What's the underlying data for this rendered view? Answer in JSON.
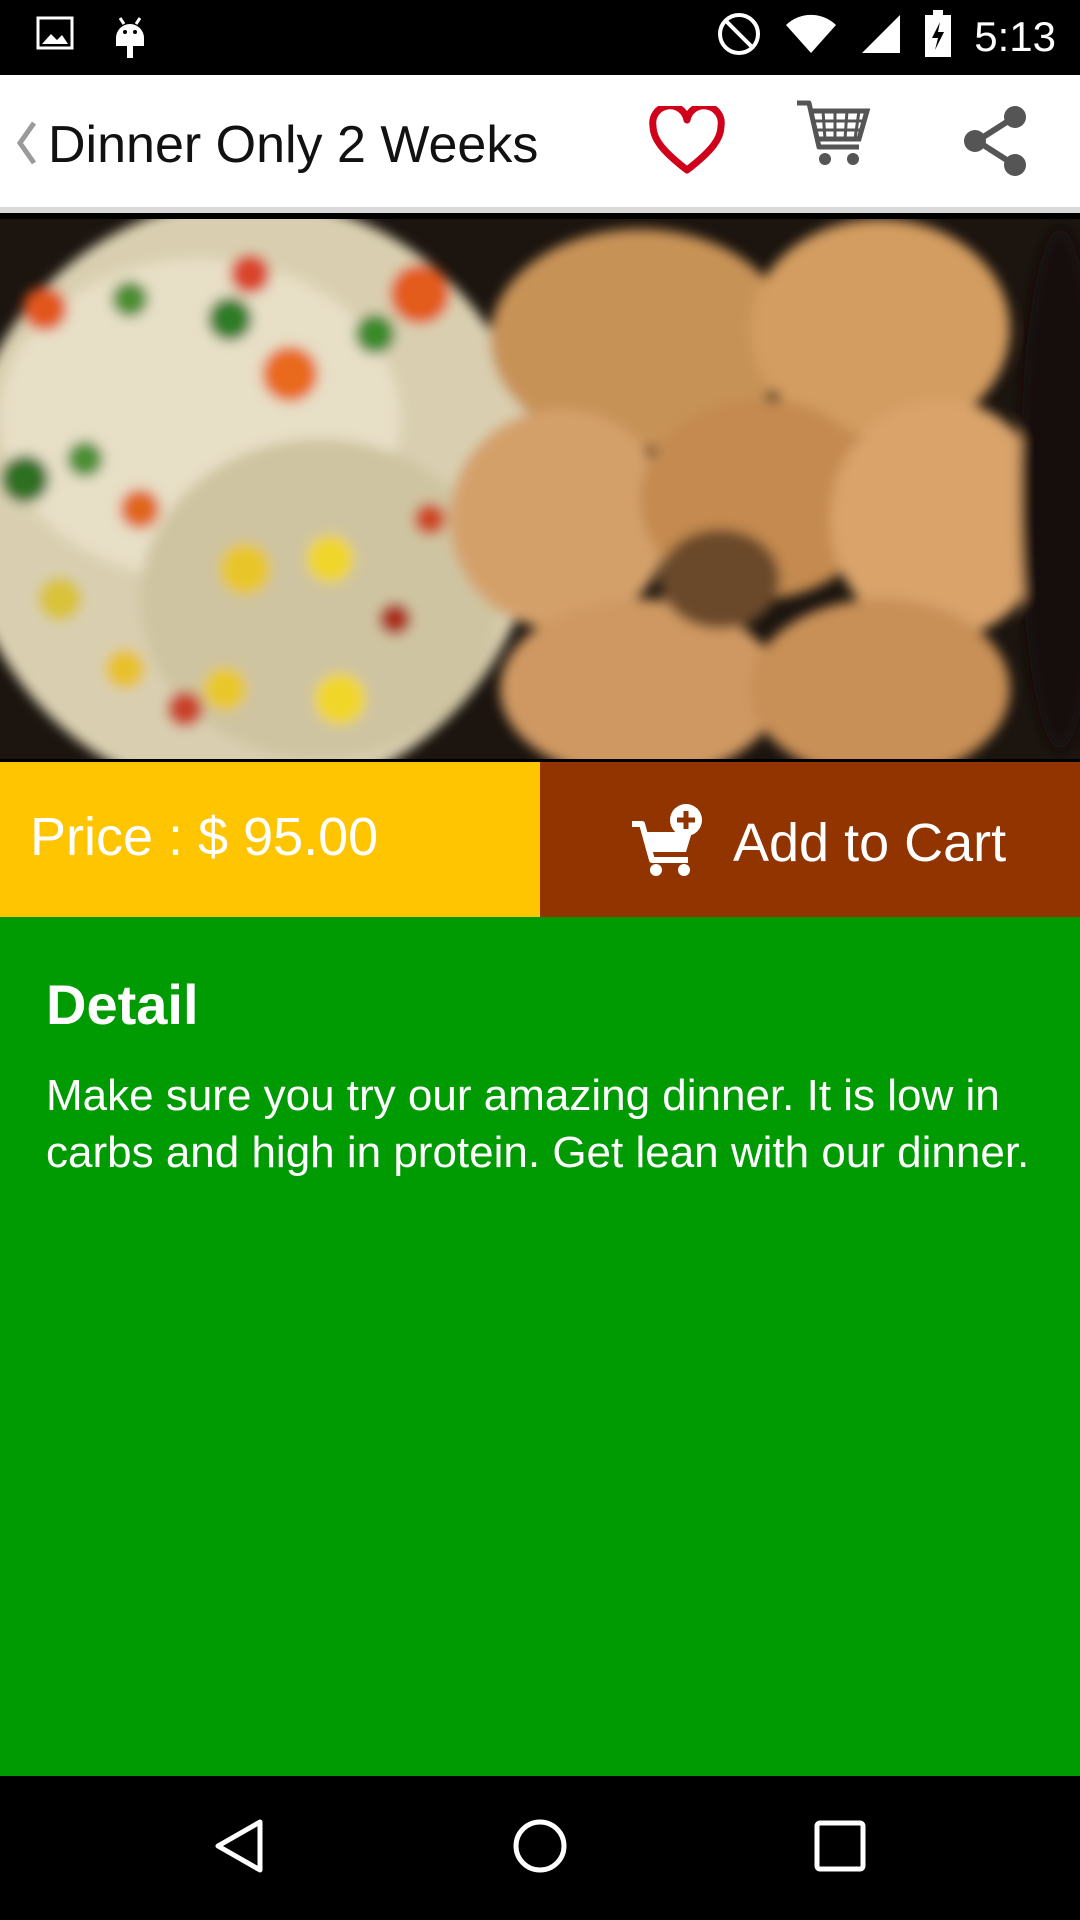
{
  "status_bar": {
    "time": "5:13",
    "left_icons": [
      "image-notification-icon",
      "android-debug-icon"
    ],
    "right_icons": [
      "do-not-disturb-icon",
      "wifi-icon",
      "cell-signal-icon",
      "battery-charging-icon"
    ]
  },
  "toolbar": {
    "title": "Dinner Only 2 Weeks",
    "icons": [
      "back-chevron-icon",
      "heart-icon",
      "cart-icon",
      "share-icon"
    ],
    "heart_color": "#d0021b"
  },
  "product": {
    "price_label": "Price : $ 95.00",
    "add_to_cart_label": "Add to Cart"
  },
  "detail": {
    "title": "Detail",
    "text": "Make sure you try our amazing dinner. It is low in carbs and high in protein. Get lean with our dinner."
  },
  "colors": {
    "price_bg": "#fec500",
    "add_cart_bg": "#913400",
    "detail_bg": "#009b03",
    "toolbar_bg": "#ffffff"
  },
  "nav_bar": {
    "icons": [
      "nav-back-icon",
      "nav-home-icon",
      "nav-recents-icon"
    ]
  }
}
